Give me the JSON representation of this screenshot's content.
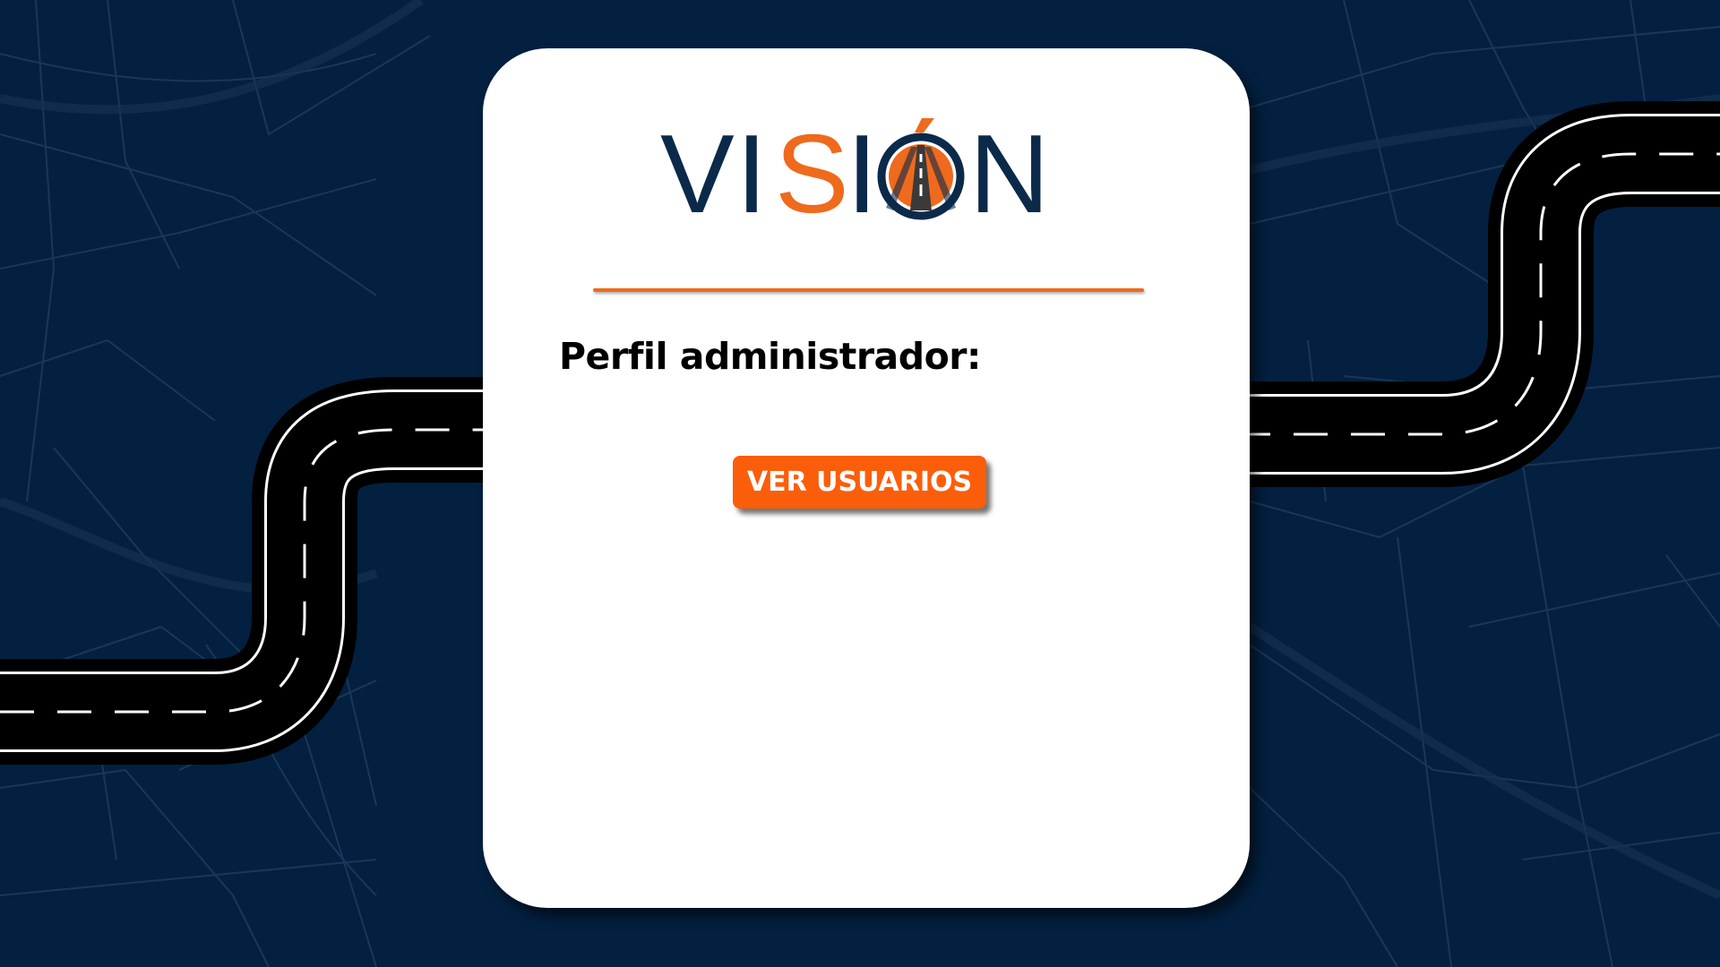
{
  "brand": {
    "name_part1": "VI",
    "name_part2": "S",
    "name_part3": "I",
    "name_part4": "N",
    "accent_color": "#ef6a1c",
    "primary_color": "#0b2a4a"
  },
  "main": {
    "profile_label": "Perfil administrador:",
    "view_users_button": "VER USUARIOS"
  },
  "theme": {
    "background": "#032040",
    "card": "#ffffff",
    "button": "#fb5e0a"
  }
}
